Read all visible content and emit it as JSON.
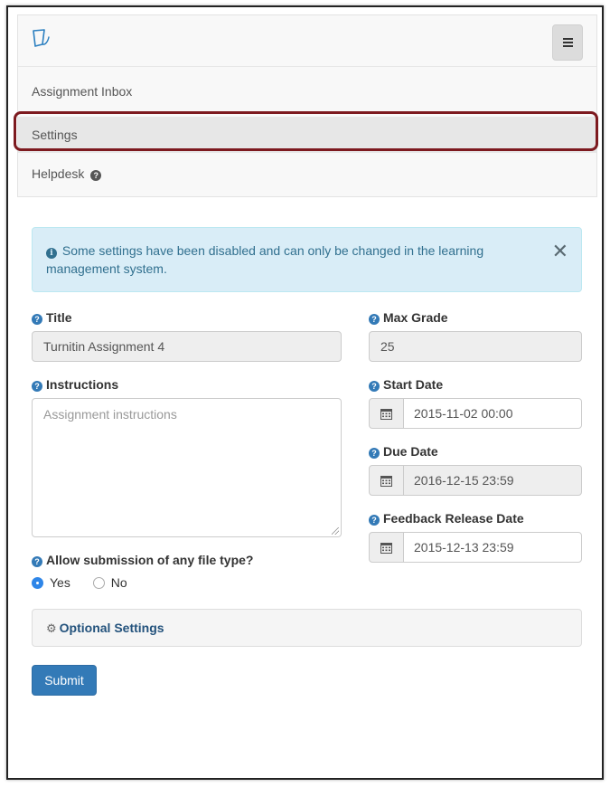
{
  "nav": {
    "logo_icon": "turnitin-logo-icon",
    "menu_icon": "hamburger-menu-icon",
    "items": [
      {
        "label": "Assignment Inbox"
      },
      {
        "label": "Settings",
        "selected": true
      },
      {
        "label": "Helpdesk",
        "icon": "help-icon"
      }
    ]
  },
  "alert": {
    "icon": "info-icon",
    "message": "Some settings have been disabled and can only be changed in the learning management system.",
    "close_icon": "close-icon"
  },
  "form": {
    "title": {
      "label": "Title",
      "value": "Turnitin Assignment 4"
    },
    "max_grade": {
      "label": "Max Grade",
      "value": "25"
    },
    "instructions": {
      "label": "Instructions",
      "placeholder": "Assignment instructions",
      "value": ""
    },
    "start_date": {
      "label": "Start Date",
      "value": "2015-11-02 00:00"
    },
    "due_date": {
      "label": "Due Date",
      "value": "2016-12-15 23:59"
    },
    "feedback_release_date": {
      "label": "Feedback Release Date",
      "value": "2015-12-13 23:59"
    },
    "file_type": {
      "label": "Allow submission of any file type?",
      "options": [
        "Yes",
        "No"
      ],
      "selected": "Yes"
    },
    "optional_settings": {
      "label": "Optional Settings",
      "icon": "gear-icon"
    },
    "submit_label": "Submit"
  },
  "colors": {
    "primary": "#337ab7",
    "alert_bg": "#d9edf7",
    "alert_text": "#31708f",
    "highlight": "#7d1a1f"
  }
}
